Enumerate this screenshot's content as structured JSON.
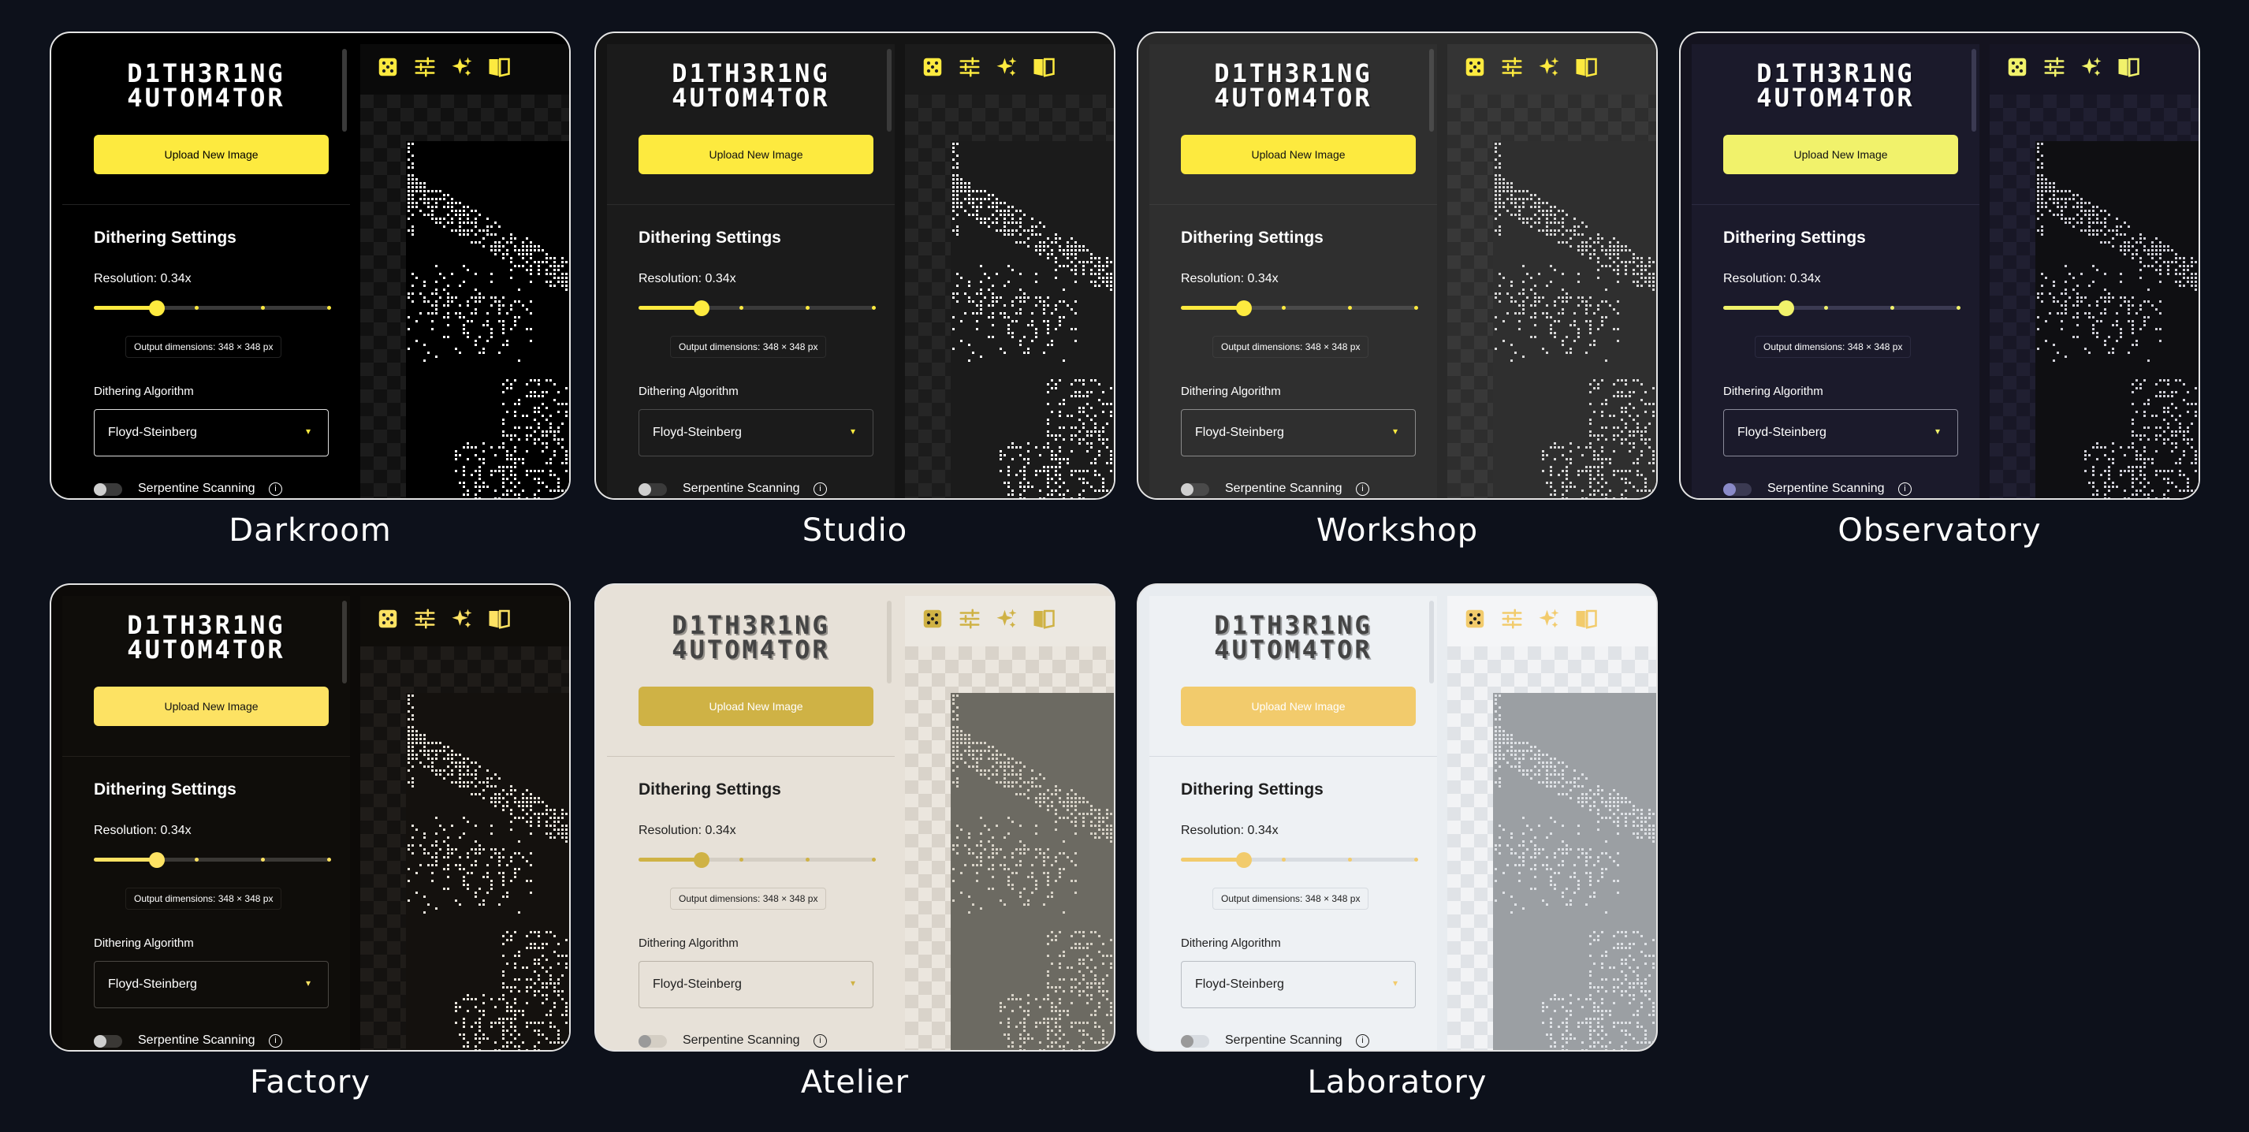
{
  "app": {
    "logo_line1": "D1TH3R1NG",
    "logo_line2": "4UTOM4TOR",
    "upload_label": "Upload New Image",
    "settings_title": "Dithering Settings",
    "resolution_label": "Resolution: 0.34x",
    "resolution_value": 0.34,
    "dimensions_label": "Output dimensions: 348 × 348 px",
    "algorithm_label": "Dithering Algorithm",
    "algorithm_value": "Floyd-Steinberg",
    "serpentine_label": "Serpentine Scanning",
    "info_glyph": "i",
    "caret_glyph": "▾",
    "toolbar_icons": [
      "dice-icon",
      "sliders-icon",
      "sparkles-icon",
      "book-icon"
    ]
  },
  "themes": [
    {
      "name": "Darkroom",
      "bg": "#000000",
      "panel": "#000000",
      "preview_bg": "#0a0a0a",
      "check_a": "#111111",
      "check_b": "#1c1c1c",
      "accent": "#fdea3f",
      "accent_text": "#000000",
      "text": "#ffffff",
      "muted": "#3a3a3a",
      "divider": "#222222",
      "logo": "#ffffff",
      "dither": "#ffffff",
      "dither_bg": "#000000",
      "select_bg": "#000000",
      "select_border": "#dcdcdc"
    },
    {
      "name": "Studio",
      "bg": "#141414",
      "panel": "#1b1b1b",
      "preview_bg": "#1b1b1b",
      "check_a": "#1c1c1c",
      "check_b": "#262626",
      "accent": "#fdea3f",
      "accent_text": "#111111",
      "text": "#ffffff",
      "muted": "#3a3a3a",
      "divider": "#2c2c2c",
      "logo": "#ffffff",
      "dither": "#ffffff",
      "dither_bg": "#1b1b1b",
      "select_bg": "#1b1b1b",
      "select_border": "#4a4a4a"
    },
    {
      "name": "Workshop",
      "bg": "#2a2a2a",
      "panel": "#2f2f2f",
      "preview_bg": "#343434",
      "check_a": "#2e2e2e",
      "check_b": "#383838",
      "accent": "#fdea3f",
      "accent_text": "#111111",
      "text": "#ffffff",
      "muted": "#4a4a4a",
      "divider": "#3c3c3c",
      "logo": "#ffffff",
      "dither": "#d8d8d8",
      "dither_bg": "#2f2f2f",
      "select_bg": "#2f2f2f",
      "select_border": "#8a8a8a"
    },
    {
      "name": "Observatory",
      "bg": "#14131f",
      "panel": "#1b1a2b",
      "preview_bg": "#161524",
      "check_a": "#181726",
      "check_b": "#201f31",
      "accent": "#f1f26b",
      "accent_text": "#111111",
      "text": "#ffffff",
      "muted": "#3b3a52",
      "divider": "#2b2a40",
      "logo": "#ffffff",
      "dither": "#d0d0d8",
      "dither_bg": "#0f0f12",
      "select_bg": "#1b1a2b",
      "select_border": "#8a8a9a"
    },
    {
      "name": "Factory",
      "bg": "#0c0a08",
      "panel": "#0f0d0a",
      "preview_bg": "#0f0d0a",
      "check_a": "#141210",
      "check_b": "#1f1c19",
      "accent": "#fde263",
      "accent_text": "#111111",
      "text": "#ffffff",
      "muted": "#3a3835",
      "divider": "#221f1b",
      "logo": "#ffffff",
      "dither": "#e8e4dc",
      "dither_bg": "#14110e",
      "select_bg": "#0f0d0a",
      "select_border": "#4a4743"
    },
    {
      "name": "Atelier",
      "bg": "#e7e1d8",
      "panel": "#e7e1d8",
      "preview_bg": "#ece8e1",
      "check_a": "#ebe6de",
      "check_b": "#d9d3ca",
      "accent": "#cfb245",
      "accent_text": "#ffffff",
      "text": "#1f1f1f",
      "muted": "#d4cec4",
      "divider": "#cdc6bb",
      "logo": "#444444",
      "dither": "#d8d3c8",
      "dither_bg": "#6c6a62",
      "select_bg": "#e7e1d8",
      "select_border": "#b9b2a7"
    },
    {
      "name": "Laboratory",
      "bg": "#e8ecf0",
      "panel": "#eef1f4",
      "preview_bg": "#f4f5f7",
      "check_a": "#f2f3f5",
      "check_b": "#e0e3e7",
      "accent": "#f2cb6c",
      "accent_text": "#ffffff",
      "text": "#1f1f1f",
      "muted": "#d8dce1",
      "divider": "#d6dbe0",
      "logo": "#444444",
      "dither": "#dfe2e6",
      "dither_bg": "#9b9fa3",
      "select_bg": "#eef1f4",
      "select_border": "#b9bec4"
    }
  ]
}
